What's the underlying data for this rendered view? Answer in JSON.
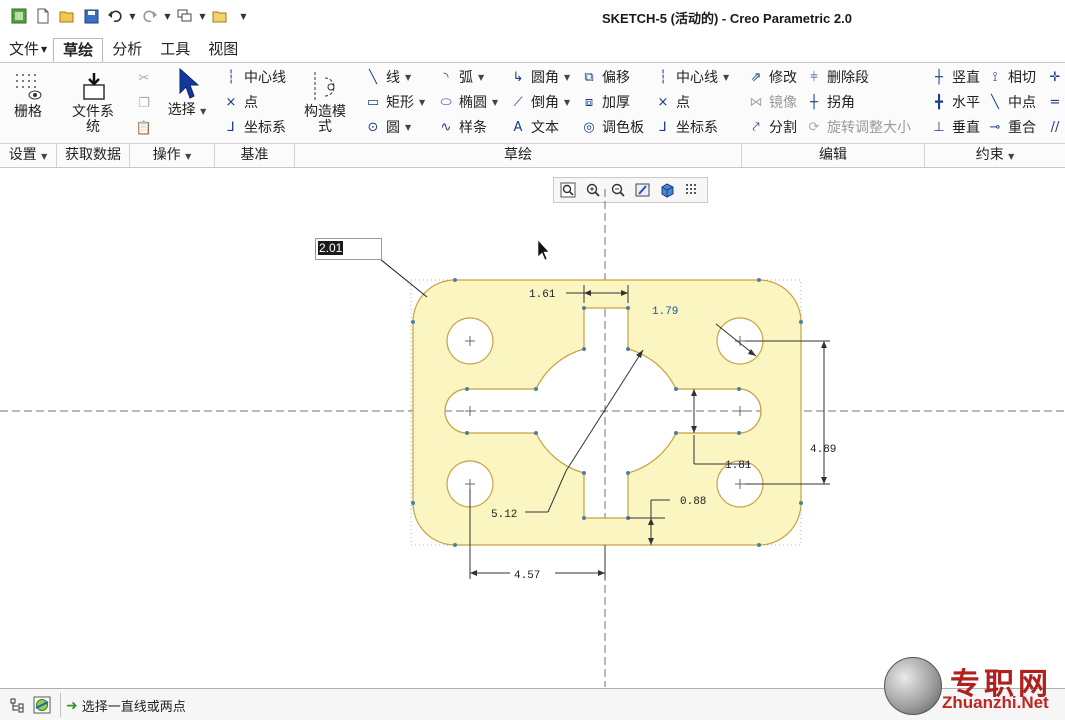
{
  "window": {
    "title": "SKETCH-5 (活动的) - Creo Parametric 2.0"
  },
  "tabs": [
    {
      "label": "文件"
    },
    {
      "label": "草绘"
    },
    {
      "label": "分析"
    },
    {
      "label": "工具"
    },
    {
      "label": "视图"
    }
  ],
  "ribbon": {
    "settings": {
      "grid": "栅格",
      "group": "设置"
    },
    "getdata": {
      "filesystem_l1": "文件系",
      "filesystem_l2": "统",
      "group": "获取数据"
    },
    "operations": {
      "select": "选择",
      "group": "操作"
    },
    "datum": {
      "centerline": "中心线",
      "point": "点",
      "csys": "坐标系",
      "group": "基准"
    },
    "construct": {
      "label_l1": "构造模",
      "label_l2": "式"
    },
    "sketching": {
      "group": "草绘",
      "line": "线",
      "rectangle": "矩形",
      "circle": "圆",
      "arc": "弧",
      "ellipse": "椭圆",
      "spline": "样条",
      "fillet": "圆角",
      "chamfer": "倒角",
      "text": "文本",
      "offset": "偏移",
      "thicken": "加厚",
      "palette": "调色板",
      "centerline": "中心线",
      "point": "点",
      "csys": "坐标系"
    },
    "editing": {
      "group": "编辑",
      "modify": "修改",
      "delete_segment": "删除段",
      "mirror": "镜像",
      "corner": "拐角",
      "divide": "分割",
      "rotate_resize": "旋转调整大小"
    },
    "constrain": {
      "group": "约束",
      "vertical": "竖直",
      "tangent": "相切",
      "horizontal": "水平",
      "midpoint": "中点",
      "perpendicular": "垂直",
      "coincident": "重合"
    }
  },
  "canvas": {
    "dim_input_value": "2.01",
    "dimensions": {
      "d1": "1.61",
      "d2": "1.79",
      "d3": "4.89",
      "d4": "1.81",
      "d5": "0.88",
      "d6": "5.12",
      "d7": "4.57"
    }
  },
  "status": {
    "message": "选择一直线或两点"
  },
  "watermark": {
    "cn": "专职网",
    "en": "Zhuanzhi.Net"
  },
  "colors": {
    "sketch_fill": "#fbf5c2",
    "sketch_stroke": "#c8a23c",
    "dim_blue": "#1f4fa8"
  }
}
